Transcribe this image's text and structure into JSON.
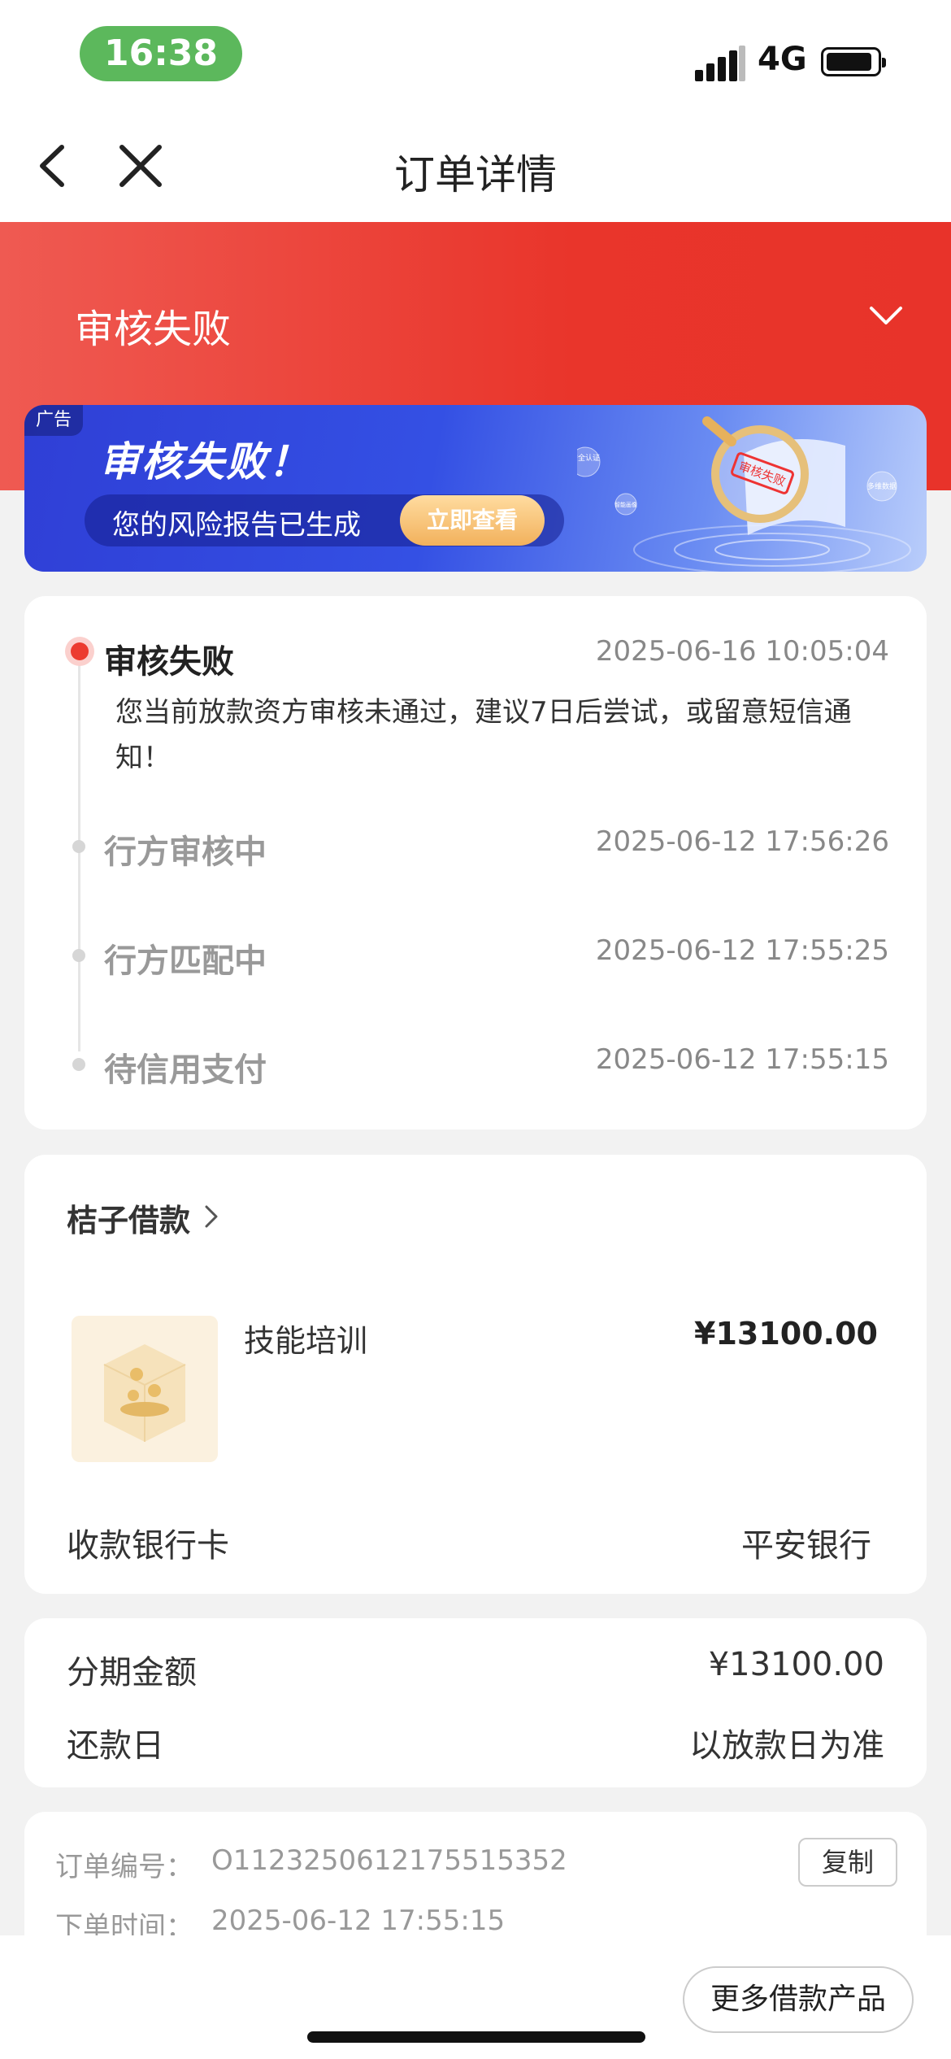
{
  "status_bar": {
    "time": "16:38",
    "network": "4G"
  },
  "nav": {
    "title": "订单详情"
  },
  "header": {
    "status_title": "审核失败"
  },
  "ad": {
    "tag": "广告",
    "title": "审核失败！",
    "subtitle": "您的风险报告已生成",
    "button": "立即查看",
    "art_badge_1": "安全认证",
    "art_badge_2": "多维数据",
    "art_badge_3": "智能画像",
    "art_seal": "审核失败"
  },
  "timeline": [
    {
      "title": "审核失败",
      "time": "2025-06-16 10:05:04",
      "desc": "您当前放款资方审核未通过，建议7日后尝试，或留意短信通知！"
    },
    {
      "title": "行方审核中",
      "time": "2025-06-12 17:56:26"
    },
    {
      "title": "行方匹配中",
      "time": "2025-06-12 17:55:25"
    },
    {
      "title": "待信用支付",
      "time": "2025-06-12 17:55:15"
    }
  ],
  "product": {
    "brand": "桔子借款",
    "name": "技能培训",
    "price": "¥13100.00",
    "bank_label": "收款银行卡",
    "bank_value": "平安银行"
  },
  "installment": {
    "amount_label": "分期金额",
    "amount_value": "¥13100.00",
    "due_label": "还款日",
    "due_value": "以放款日为准"
  },
  "order": {
    "number_label": "订单编号：",
    "number_value": "O1123250612175515352",
    "copy_button": "复制",
    "time_label": "下单时间：",
    "time_value": "2025-06-12 17:55:15"
  },
  "bottom": {
    "more_button": "更多借款产品"
  },
  "colors": {
    "accent_red": "#e9352b",
    "ad_blue": "#3450e4"
  }
}
